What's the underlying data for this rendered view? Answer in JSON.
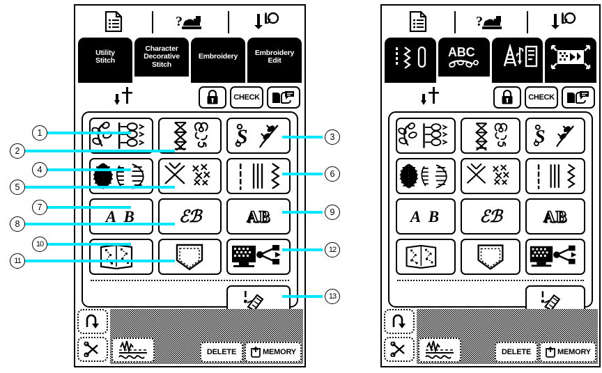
{
  "figure": {
    "title": "Sewing machine pattern selection screens",
    "accent_color": "#00e5ff",
    "ink_color": "#000000",
    "background_color": "#ffffff"
  },
  "panels": [
    {
      "id": "left",
      "variant": "text-tabs",
      "has_callouts": true
    },
    {
      "id": "right",
      "variant": "icon-tabs",
      "has_callouts": false
    }
  ],
  "statusbar": {
    "items": [
      {
        "icon": "document-list-icon",
        "name": "settings-page-icon"
      },
      {
        "icon": "machine-help-icon",
        "name": "machine-help-icon"
      },
      {
        "icon": "needle-threader-icon",
        "name": "needle-threader-icon"
      }
    ]
  },
  "tabs_text": {
    "selected_index": 1,
    "items": [
      {
        "label": "Utility\nStitch",
        "line1": "Utility",
        "line2": "Stitch",
        "line3": ""
      },
      {
        "label": "Character Decorative Stitch",
        "line1": "Character",
        "line2": "Decorative",
        "line3": "Stitch"
      },
      {
        "label": "Embroidery",
        "line1": "Embroidery",
        "line2": "",
        "line3": ""
      },
      {
        "label": "Embroidery Edit",
        "line1": "Embroidery",
        "line2": "Edit",
        "line3": ""
      }
    ]
  },
  "tabs_icon": {
    "selected_index": 1,
    "items": [
      {
        "icon": "utility-stitch-icon",
        "name": "tab-utility-stitch"
      },
      {
        "icon": "abc-decorative-icon",
        "name": "tab-character-decorative-stitch"
      },
      {
        "icon": "embroidery-icon",
        "name": "tab-embroidery"
      },
      {
        "icon": "embroidery-edit-icon",
        "name": "tab-embroidery-edit"
      }
    ]
  },
  "utility_row": {
    "needle_position": {
      "icon": "needle-down-position-icon",
      "name": "needle-position-indicator"
    },
    "buttons": [
      {
        "name": "lock-button",
        "icon": "lock-icon",
        "label": ""
      },
      {
        "name": "check-button",
        "icon": "",
        "label": "CHECK"
      },
      {
        "name": "manual-button",
        "icon": "manual-book-icon",
        "label": ""
      }
    ]
  },
  "pattern_grid": {
    "rows": [
      [
        {
          "name": "decorative-stitch-button",
          "icon": "floral-decorative-stitch-icon",
          "callout": 1
        },
        {
          "name": "cross-stitch-button",
          "icon": "cross-stitch-icon",
          "callout": 2
        },
        {
          "name": "satin-stitch-button",
          "icon": "satin-stitch-icon",
          "callout": 3
        }
      ],
      [
        {
          "name": "satin-shape-button",
          "icon": "satin-shape-icon",
          "callout": 4
        },
        {
          "name": "candlewicking-button",
          "icon": "candlewicking-stitch-icon",
          "callout": 5
        },
        {
          "name": "utility-decorative-button",
          "icon": "utility-stitch-lines-icon",
          "callout": 6
        }
      ],
      [
        {
          "name": "font-gothic-button",
          "icon": "",
          "label": "A B",
          "style": "ab-italic",
          "callout": 7
        },
        {
          "name": "font-script-button",
          "icon": "",
          "label": "ℰℬ",
          "style": "ab-script",
          "callout": 8
        },
        {
          "name": "font-outline-button",
          "icon": "",
          "label": "AB",
          "style": "ab-outline",
          "callout": 9
        }
      ],
      [
        {
          "name": "my-custom-stitch-button",
          "icon": "custom-stitch-design-icon",
          "callout": 10
        },
        {
          "name": "pocket-stitch-button",
          "icon": "pocket-icon",
          "callout": 11
        },
        {
          "name": "usb-transfer-button",
          "icon": "usb-pc-transfer-icon",
          "callout": 12
        }
      ]
    ],
    "extra_row": [
      {
        "name": "my-custom-design-button",
        "icon": "stylus-design-icon",
        "callout": 13
      }
    ]
  },
  "bottom_bar": {
    "left_keys": [
      {
        "name": "reverse-stitch-button",
        "icon": "reverse-stitch-icon"
      },
      {
        "name": "thread-cutter-button",
        "icon": "scissors-icon"
      }
    ],
    "buttons": [
      {
        "name": "stitch-settings-button",
        "icon": "stitch-settings-icon",
        "label": ""
      },
      {
        "name": "delete-button",
        "icon": "",
        "label": "DELETE"
      },
      {
        "name": "memory-button",
        "icon": "memory-card-icon",
        "label": "MEMORY"
      }
    ]
  },
  "callouts": {
    "left": [
      {
        "number": "①",
        "text": "1"
      },
      {
        "number": "②",
        "text": "2"
      },
      {
        "number": "④",
        "text": "4"
      },
      {
        "number": "⑤",
        "text": "5"
      },
      {
        "number": "⑦",
        "text": "7"
      },
      {
        "number": "⑧",
        "text": "8"
      },
      {
        "number": "⑩",
        "text": "10"
      },
      {
        "number": "⑪",
        "text": "11"
      }
    ],
    "right": [
      {
        "number": "③",
        "text": "3"
      },
      {
        "number": "⑥",
        "text": "6"
      },
      {
        "number": "⑨",
        "text": "9"
      },
      {
        "number": "⑫",
        "text": "12"
      },
      {
        "number": "⑬",
        "text": "13"
      }
    ]
  }
}
